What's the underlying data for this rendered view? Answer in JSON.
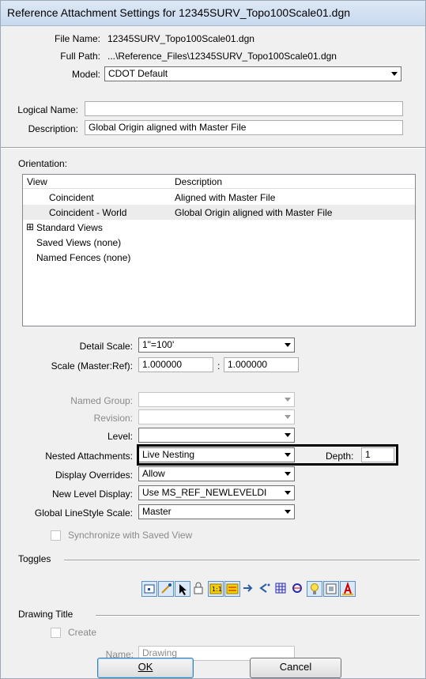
{
  "title": "Reference Attachment Settings for 12345SURV_Topo100Scale01.dgn",
  "file": {
    "file_name_label": "File Name:",
    "file_name": "12345SURV_Topo100Scale01.dgn",
    "full_path_label": "Full Path:",
    "full_path": "...\\Reference_Files\\12345SURV_Topo100Scale01.dgn",
    "model_label": "Model:",
    "model": "CDOT Default",
    "logical_name_label": "Logical Name:",
    "logical_name": "",
    "description_label": "Description:",
    "description": "Global Origin aligned with Master File"
  },
  "orientation": {
    "label": "Orientation:",
    "col_view": "View",
    "col_description": "Description",
    "rows": [
      {
        "view": "Coincident",
        "description": "Aligned with Master File"
      },
      {
        "view": "Coincident - World",
        "description": "Global Origin aligned with Master File"
      },
      {
        "view": "Standard Views",
        "description": "",
        "expander": "⊞"
      },
      {
        "view": "Saved Views (none)",
        "description": ""
      },
      {
        "view": "Named Fences (none)",
        "description": ""
      }
    ]
  },
  "scale": {
    "detail_scale_label": "Detail Scale:",
    "detail_scale": "1\"=100'",
    "scale_label": "Scale (Master:Ref):",
    "master": "1.000000",
    "colon": ":",
    "ref": "1.000000"
  },
  "settings": {
    "named_group_label": "Named Group:",
    "named_group": "",
    "revision_label": "Revision:",
    "revision": "",
    "level_label": "Level:",
    "level": "",
    "nested_label": "Nested Attachments:",
    "nested": "Live Nesting",
    "depth_label": "Depth:",
    "depth": "1",
    "display_overrides_label": "Display Overrides:",
    "display_overrides": "Allow",
    "new_level_label": "New Level Display:",
    "new_level": "Use MS_REF_NEWLEVELDI",
    "linestyle_label": "Global LineStyle Scale:",
    "linestyle": "Master",
    "sync_label": "Synchronize with Saved View"
  },
  "toggles": {
    "label": "Toggles",
    "icons": [
      "display-icon",
      "snap-icon",
      "locate-icon",
      "lock-icon",
      "scale-lines-icon",
      "ignore-attachment-icon",
      "treat-as-element-icon",
      "rotation-icon",
      "clip-icon",
      "hidden-lines-icon",
      "light-icon",
      "raster-icon",
      "annotation-icon"
    ]
  },
  "drawing_title": {
    "label": "Drawing Title",
    "create_label": "Create",
    "name_label": "Name:",
    "name_value": "Drawing"
  },
  "buttons": {
    "ok": "OK",
    "cancel": "Cancel"
  },
  "colors": {
    "highlight_border": "#000000",
    "selected_row": "#ececec"
  }
}
